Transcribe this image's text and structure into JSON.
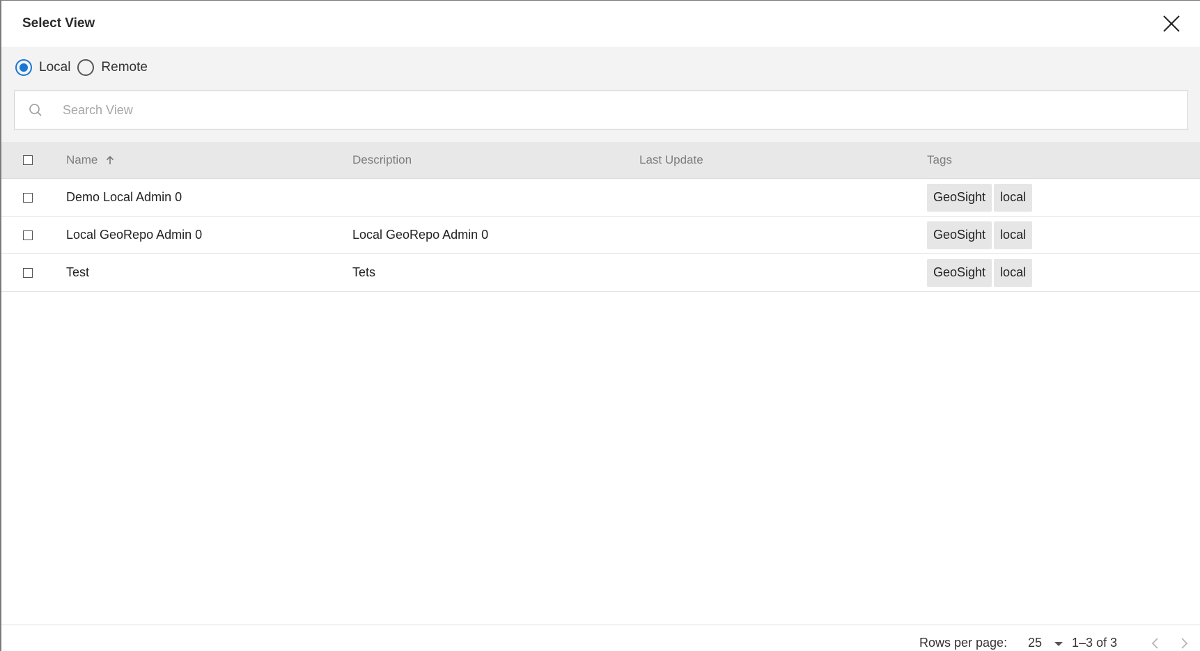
{
  "dialog": {
    "title": "Select View",
    "close_icon": "close-icon"
  },
  "source": {
    "options": [
      {
        "label": "Local",
        "checked": true
      },
      {
        "label": "Remote",
        "checked": false
      }
    ]
  },
  "search": {
    "placeholder": "Search View",
    "value": "",
    "icon": "search-icon"
  },
  "table": {
    "columns": {
      "name": "Name",
      "description": "Description",
      "last_update": "Last Update",
      "tags": "Tags"
    },
    "sort": {
      "column": "name",
      "direction": "ascending",
      "icon": "arrow-up-icon"
    },
    "rows": [
      {
        "name": "Demo Local Admin 0",
        "description": "",
        "last_update": "",
        "tags": [
          "GeoSight",
          "local"
        ]
      },
      {
        "name": "Local GeoRepo Admin 0",
        "description": "Local GeoRepo Admin 0",
        "last_update": "",
        "tags": [
          "GeoSight",
          "local"
        ]
      },
      {
        "name": "Test",
        "description": "Tets",
        "last_update": "",
        "tags": [
          "GeoSight",
          "local"
        ]
      }
    ]
  },
  "pagination": {
    "rows_per_page_label": "Rows per page:",
    "rows_per_page": "25",
    "range": "1–3 of 3"
  },
  "colors": {
    "accent": "#1976d2",
    "header_bg": "#e8e8e8",
    "filter_bg": "#f3f3f3",
    "tag_bg": "#e6e6e6"
  }
}
